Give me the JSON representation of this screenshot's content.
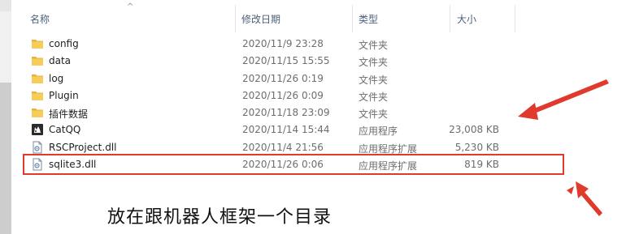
{
  "columns": {
    "name": "名称",
    "date": "修改日期",
    "type": "类型",
    "size": "大小"
  },
  "files": [
    {
      "icon": "folder-icon",
      "name": "config",
      "date": "2020/11/9 23:28",
      "type": "文件夹",
      "size": ""
    },
    {
      "icon": "folder-icon",
      "name": "data",
      "date": "2020/11/15 15:55",
      "type": "文件夹",
      "size": ""
    },
    {
      "icon": "folder-icon",
      "name": "log",
      "date": "2020/11/26 0:19",
      "type": "文件夹",
      "size": ""
    },
    {
      "icon": "folder-icon",
      "name": "Plugin",
      "date": "2020/11/26 0:09",
      "type": "文件夹",
      "size": ""
    },
    {
      "icon": "folder-icon",
      "name": "插件数据",
      "date": "2020/11/18 23:09",
      "type": "文件夹",
      "size": ""
    },
    {
      "icon": "app-icon",
      "name": "CatQQ",
      "date": "2020/11/14 15:44",
      "type": "应用程序",
      "size": "23,008 KB"
    },
    {
      "icon": "dll-icon",
      "name": "RSCProject.dll",
      "date": "2020/11/4 21:56",
      "type": "应用程序扩展",
      "size": "5,230 KB"
    },
    {
      "icon": "dll-icon",
      "name": "sqlite3.dll",
      "date": "2020/11/26 0:06",
      "type": "应用程序扩展",
      "size": "819 KB"
    }
  ],
  "annotation": {
    "text": "放在跟机器人框架一个目录",
    "color": "#e03a2d"
  },
  "colors": {
    "folder": "#f3c14a",
    "header_text": "#4c607a",
    "annotation_red": "#e03a2d"
  }
}
